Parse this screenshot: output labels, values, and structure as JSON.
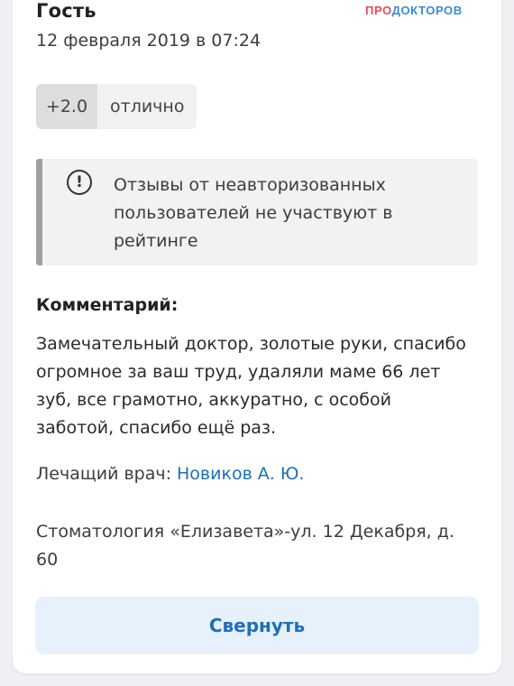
{
  "review": {
    "author": "Гость",
    "date": "12 февраля 2019 в 07:24",
    "rating": {
      "score": "+2.0",
      "label": "отлично"
    },
    "notice": {
      "icon": "exclamation-circle-icon",
      "text": "Отзывы от неавторизованных пользователей не участвуют в рейтинге"
    },
    "comment": {
      "title": "Комментарий:",
      "text": "Замечательный доктор, золотые руки, спасибо огромное за ваш труд, удаляли маме 66 лет зуб, все грамотно, аккуратно, с особой заботой, спасибо ещё раз."
    },
    "doctor": {
      "label": "Лечащий врач:",
      "name": "Новиков А. Ю."
    },
    "clinic": "Стоматология «Елизавета»-ул. 12 Декабря, д. 60",
    "collapse_label": "Свернуть"
  },
  "logo": {
    "part1": "ПРО",
    "part2": "ДОКТОРОВ"
  },
  "colors": {
    "link": "#1f6fb5",
    "button_bg": "#e6f1fb",
    "logo_red": "#e5495b",
    "logo_blue": "#3a8ad6"
  }
}
